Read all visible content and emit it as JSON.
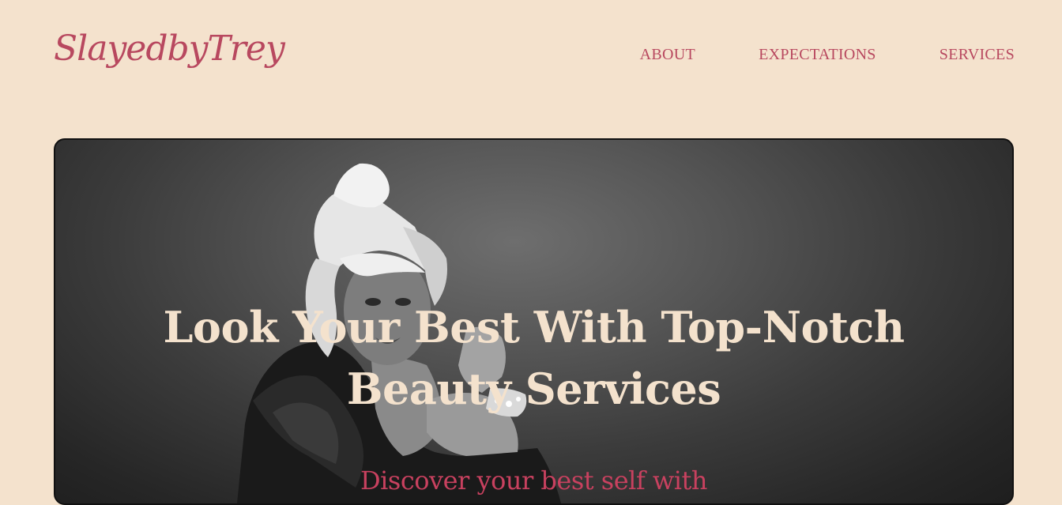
{
  "header": {
    "logo": "SlayedbyTrey",
    "nav": [
      {
        "label": "ABOUT"
      },
      {
        "label": "EXPECTATIONS"
      },
      {
        "label": "SERVICES"
      }
    ]
  },
  "hero": {
    "title_line1": "Look Your Best With Top-Notch",
    "title_line2": "Beauty Services",
    "subtitle": "Discover your best self with",
    "image_subject": "monochrome portrait of a woman with a blonde updo and bangs"
  },
  "colors": {
    "background": "#f4e2cd",
    "accent": "#b8485f",
    "hero_text": "#f4e2cd",
    "hero_sub": "#c8415f"
  }
}
